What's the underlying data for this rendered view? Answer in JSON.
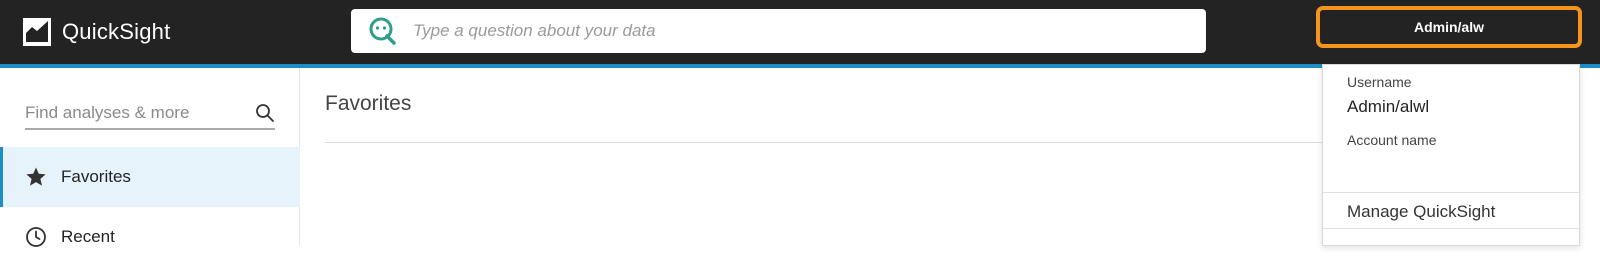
{
  "topbar": {
    "brand_name": "QuickSight",
    "search_placeholder": "Type a question about your data",
    "user_button_label": "Admin/alw",
    "accent_color": "#1f8ec5",
    "highlight_color": "#f7941d"
  },
  "sidebar": {
    "search_placeholder": "Find analyses & more",
    "items": [
      {
        "label": "Favorites",
        "icon": "star-icon",
        "active": true
      },
      {
        "label": "Recent",
        "icon": "clock-icon",
        "active": false
      }
    ]
  },
  "main": {
    "title": "Favorites"
  },
  "user_menu": {
    "username_label": "Username",
    "username_value": "Admin/alwl",
    "account_label": "Account name",
    "account_value": "",
    "items": [
      {
        "label": "Manage QuickSight"
      }
    ]
  }
}
